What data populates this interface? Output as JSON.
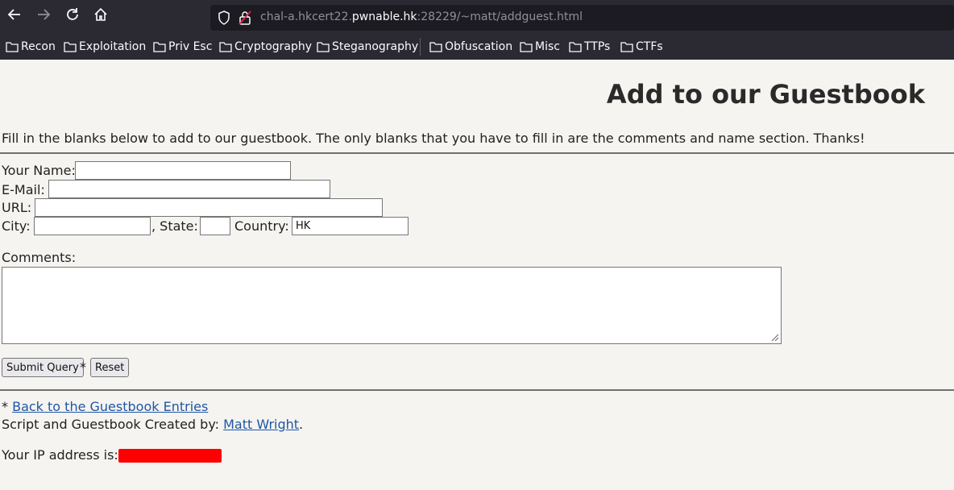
{
  "browser": {
    "url_prefix": "chal-a.hkcert22.",
    "url_host": "pwnable.hk",
    "url_suffix": ":28229/~matt/addguest.html",
    "bookmarks": [
      "Recon",
      "Exploitation",
      "Priv Esc",
      "Cryptography",
      "Steganography",
      "Obfuscation",
      "Misc",
      "TTPs",
      "CTFs"
    ]
  },
  "page": {
    "title": "Add to our Guestbook",
    "intro": "Fill in the blanks below to add to our guestbook. The only blanks that you have to fill in are the comments and name section. Thanks!",
    "form": {
      "name_label": "Your Name:",
      "email_label": "E-Mail:",
      "url_label": "URL:",
      "city_label": "City:",
      "state_label": ", State:",
      "country_label": "Country:",
      "country_value": "HK",
      "comments_label": "Comments:",
      "submit_label": "Submit Query",
      "asterisk": "*",
      "reset_label": "Reset"
    },
    "footer": {
      "asterisk": "*",
      "back_link": "Back to the Guestbook Entries",
      "credit_prefix": "Script and Guestbook Created by:",
      "credit_link": "Matt Wright",
      "credit_suffix": ".",
      "ip_label": "Your IP address is:"
    }
  }
}
